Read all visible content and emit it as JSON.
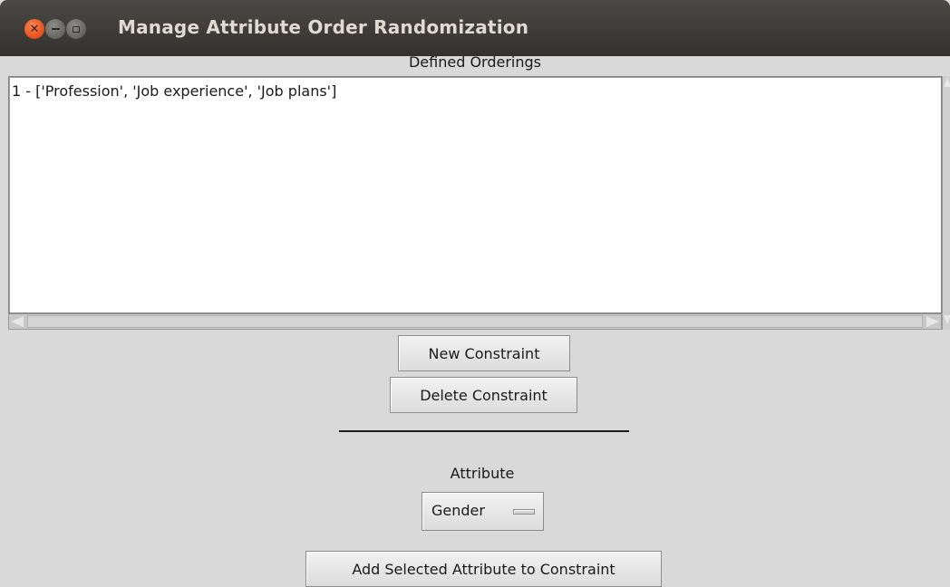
{
  "window": {
    "title": "Manage Attribute Order Randomization",
    "controls": {
      "close_icon": "close-icon",
      "minimize_icon": "minimize-icon",
      "maximize_icon": "maximize-icon"
    }
  },
  "orderings": {
    "label": "Defined Orderings",
    "items": [
      "1 - ['Profession', 'Job experience', 'Job plans']"
    ]
  },
  "buttons": {
    "new_constraint": "New Constraint",
    "delete_constraint": "Delete Constraint",
    "add_attribute": "Add Selected Attribute to Constraint"
  },
  "attribute": {
    "label": "Attribute",
    "selected": "Gender"
  },
  "colors": {
    "titlebar": "#3c3b37",
    "close_button": "#e9541f",
    "window_bg": "#d9d9d9"
  }
}
